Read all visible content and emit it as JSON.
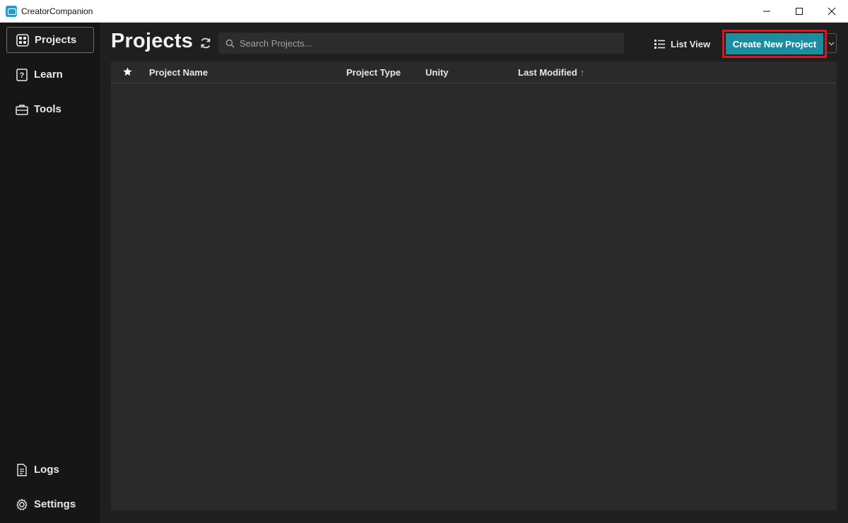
{
  "window": {
    "title": "CreatorCompanion",
    "controls": [
      "minimize-icon",
      "maximize-icon",
      "close-icon"
    ]
  },
  "sidebar": {
    "items": [
      {
        "label": "Projects",
        "icon": "grid-icon",
        "active": true
      },
      {
        "label": "Learn",
        "icon": "question-box-icon",
        "active": false
      },
      {
        "label": "Tools",
        "icon": "toolbox-icon",
        "active": false
      }
    ],
    "bottom_items": [
      {
        "label": "Logs",
        "icon": "document-icon"
      },
      {
        "label": "Settings",
        "icon": "gear-icon"
      }
    ]
  },
  "header": {
    "title": "Projects",
    "refresh_icon": "refresh-icon",
    "search_placeholder": "Search Projects...",
    "search_value": "",
    "list_view_label": "List View",
    "create_button_label": "Create New Project"
  },
  "table": {
    "columns": [
      {
        "key": "favorite",
        "label": "",
        "icon": "star-icon"
      },
      {
        "key": "name",
        "label": "Project Name"
      },
      {
        "key": "type",
        "label": "Project Type"
      },
      {
        "key": "unity",
        "label": "Unity"
      },
      {
        "key": "modified",
        "label": "Last Modified",
        "sort": "ascending"
      }
    ],
    "sort_indicator": "↑",
    "rows": []
  },
  "colors": {
    "accent": "#1a8ea0",
    "highlight_border": "#e0151e",
    "sidebar_bg": "#161616",
    "main_bg": "#1f1f1f",
    "table_bg": "#2a2a2a"
  }
}
